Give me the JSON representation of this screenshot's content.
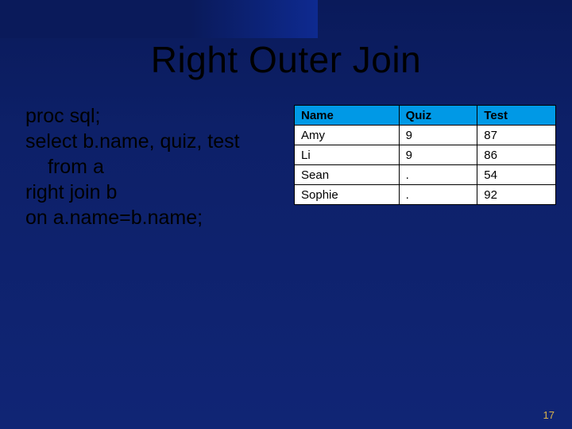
{
  "title": "Right Outer Join",
  "code": {
    "l1": "proc sql;",
    "l2": "select b.name, quiz, test",
    "l3": "from a",
    "l4": "right join b",
    "l5": "on a.name=b.name;"
  },
  "table": {
    "headers": {
      "c1": "Name",
      "c2": "Quiz",
      "c3": "Test"
    },
    "rows": [
      {
        "c1": "Amy",
        "c2": "9",
        "c3": "87"
      },
      {
        "c1": "Li",
        "c2": "9",
        "c3": "86"
      },
      {
        "c1": "Sean",
        "c2": ".",
        "c3": "54"
      },
      {
        "c1": "Sophie",
        "c2": ".",
        "c3": "92"
      }
    ]
  },
  "page_number": "17"
}
